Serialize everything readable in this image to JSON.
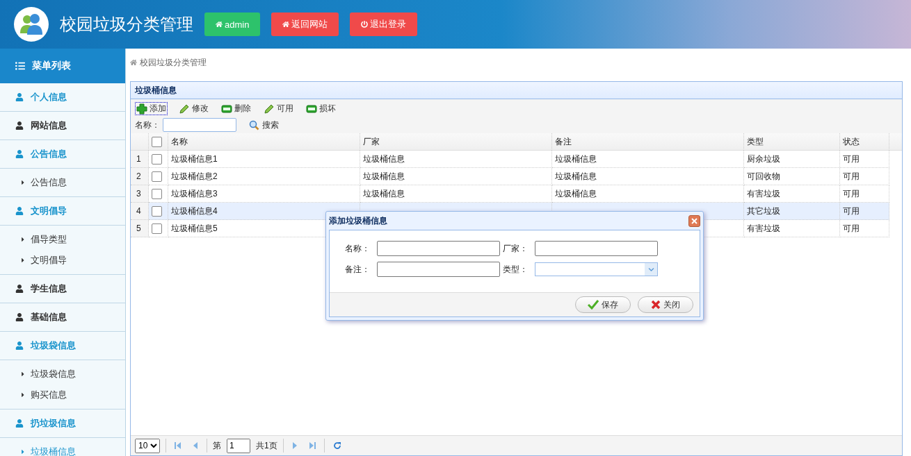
{
  "header": {
    "title": "校园垃圾分类管理",
    "buttons": [
      {
        "label": "admin",
        "kind": "user"
      },
      {
        "label": "返回网站",
        "kind": "home"
      },
      {
        "label": "退出登录",
        "kind": "logout"
      }
    ]
  },
  "sidebar": {
    "title": "菜单列表",
    "groups": [
      {
        "label": "个人信息",
        "active": true
      },
      {
        "label": "网站信息",
        "active": false
      },
      {
        "label": "公告信息",
        "active": true,
        "children": [
          {
            "label": "公告信息",
            "selected": false
          }
        ]
      },
      {
        "label": "文明倡导",
        "active": true,
        "children": [
          {
            "label": "倡导类型",
            "selected": false
          },
          {
            "label": "文明倡导",
            "selected": false
          }
        ]
      },
      {
        "label": "学生信息",
        "active": false
      },
      {
        "label": "基础信息",
        "active": false
      },
      {
        "label": "垃圾袋信息",
        "active": true,
        "children": [
          {
            "label": "垃圾袋信息",
            "selected": false
          },
          {
            "label": "购买信息",
            "selected": false
          }
        ]
      },
      {
        "label": "扔垃圾信息",
        "active": true,
        "children": [
          {
            "label": "垃圾桶信息",
            "selected": true
          }
        ]
      }
    ]
  },
  "breadcrumb": "校园垃圾分类管理",
  "panel": {
    "title": "垃圾桶信息",
    "toolbar": [
      {
        "label": "添加",
        "kind": "add",
        "focused": true
      },
      {
        "label": "修改",
        "kind": "edit",
        "focused": false
      },
      {
        "label": "删除",
        "kind": "remove",
        "focused": false
      },
      {
        "label": "可用",
        "kind": "edit",
        "focused": false
      },
      {
        "label": "损坏",
        "kind": "remove",
        "focused": false
      }
    ],
    "search": {
      "label": "名称：",
      "button": "搜索"
    },
    "table": {
      "all_checked": false,
      "columns": [
        "名称",
        "厂家",
        "备注",
        "类型",
        "状态"
      ],
      "rows": [
        {
          "number": "1",
          "checked": false,
          "highlighted": false,
          "cells": [
            "垃圾桶信息1",
            "垃圾桶信息",
            "垃圾桶信息",
            "厨余垃圾",
            "可用"
          ]
        },
        {
          "number": "2",
          "checked": false,
          "highlighted": false,
          "cells": [
            "垃圾桶信息2",
            "垃圾桶信息",
            "垃圾桶信息",
            "可回收物",
            "可用"
          ]
        },
        {
          "number": "3",
          "checked": false,
          "highlighted": false,
          "cells": [
            "垃圾桶信息3",
            "垃圾桶信息",
            "垃圾桶信息",
            "有害垃圾",
            "可用"
          ]
        },
        {
          "number": "4",
          "checked": false,
          "highlighted": true,
          "cells": [
            "垃圾桶信息4",
            null,
            null,
            "其它垃圾",
            "可用"
          ]
        },
        {
          "number": "5",
          "checked": false,
          "highlighted": false,
          "cells": [
            "垃圾桶信息5",
            null,
            null,
            "有害垃圾",
            "可用"
          ]
        }
      ]
    },
    "pager": {
      "page_size": "10",
      "page_prefix": "第",
      "page": "1",
      "total": "共1页"
    }
  },
  "dialog": {
    "title": "添加垃圾桶信息",
    "fields": [
      {
        "label": "名称：",
        "kind": "text"
      },
      {
        "label": "厂家：",
        "kind": "text"
      },
      {
        "label": "备注：",
        "kind": "text"
      },
      {
        "label": "类型：",
        "kind": "select"
      }
    ],
    "buttons": [
      {
        "label": "保存",
        "kind": "save"
      },
      {
        "label": "关闭",
        "kind": "close"
      }
    ]
  }
}
